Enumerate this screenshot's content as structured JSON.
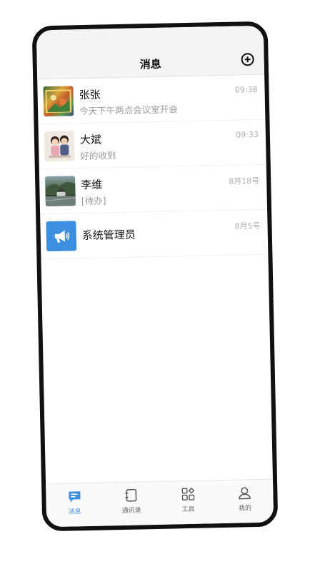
{
  "header": {
    "title": "消息"
  },
  "messages": [
    {
      "name": "张张",
      "preview": "今天下午两点会议室开会",
      "time": "09:38"
    },
    {
      "name": "大斌",
      "preview": "好的收到",
      "time": "09:33"
    },
    {
      "name": "李维",
      "preview": "[待办]",
      "time": "8月18号"
    },
    {
      "name": "系统管理员",
      "preview": "",
      "time": "8月5号"
    }
  ],
  "tabs": [
    {
      "label": "消息",
      "active": true
    },
    {
      "label": "通讯录"
    },
    {
      "label": "工具"
    },
    {
      "label": "我的"
    }
  ],
  "colors": {
    "accent": "#3d8fe0"
  }
}
